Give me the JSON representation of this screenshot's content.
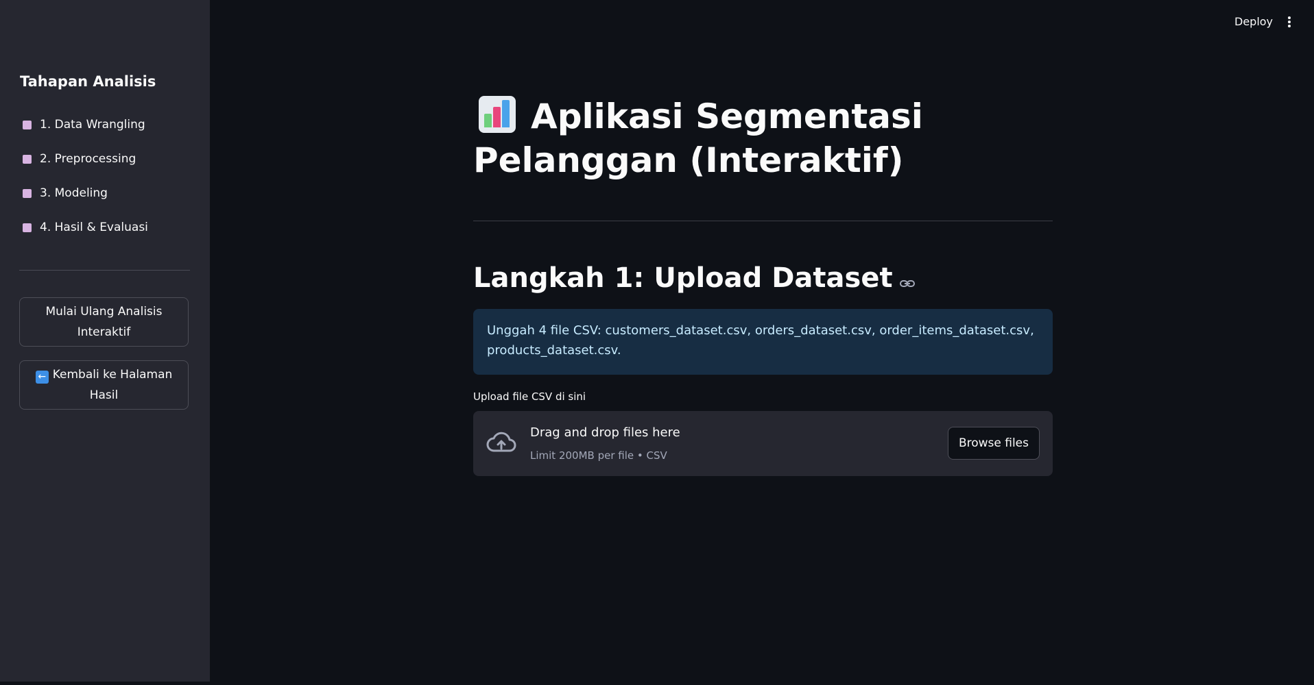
{
  "header": {
    "deploy_label": "Deploy",
    "menu_icon": "vertical-ellipsis"
  },
  "sidebar": {
    "title": "Tahapan Analisis",
    "steps": [
      {
        "label": "1. Data Wrangling",
        "status_color": "#d8b4e2"
      },
      {
        "label": "2. Preprocessing",
        "status_color": "#d8b4e2"
      },
      {
        "label": "3. Modeling",
        "status_color": "#d8b4e2"
      },
      {
        "label": "4. Hasil & Evaluasi",
        "status_color": "#d8b4e2"
      }
    ],
    "restart_button": "Mulai Ulang Analisis Interaktif",
    "back_button": {
      "icon": "left-arrow-icon",
      "label": "Kembali ke Halaman Hasil"
    }
  },
  "main": {
    "title_icon": "bar-chart-icon",
    "title": "Aplikasi Segmentasi Pelanggan (Interaktif)",
    "section_heading": "Langkah 1: Upload Dataset",
    "info_text": "Unggah 4 file CSV: customers_dataset.csv, orders_dataset.csv, order_items_dataset.csv, products_dataset.csv.",
    "upload": {
      "label": "Upload file CSV di sini",
      "drop_title": "Drag and drop files here",
      "limit_text": "Limit 200MB per file • CSV",
      "browse_label": "Browse files"
    }
  },
  "colors": {
    "background": "#0e1117",
    "sidebar": "#262730",
    "info_box": "#172d43",
    "info_text": "#c7ebff",
    "step_marker": "#d8b4e2"
  }
}
